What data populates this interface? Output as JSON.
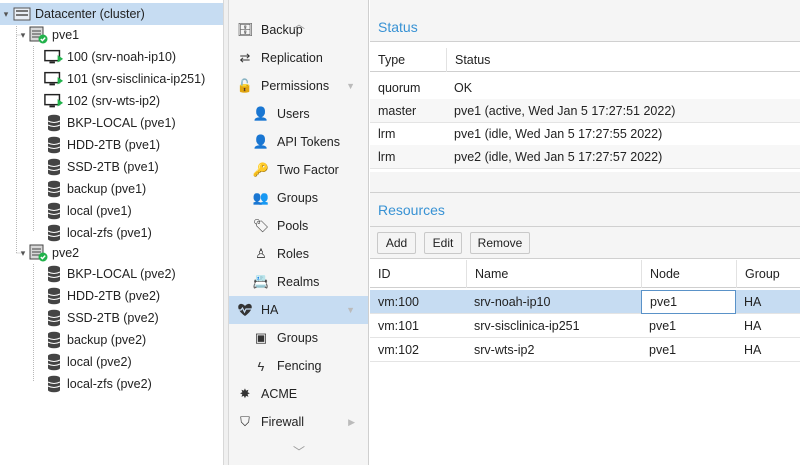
{
  "tree": {
    "datacenter": "Datacenter (cluster)",
    "nodes": [
      {
        "name": "pve1",
        "vms": [
          "100 (srv-noah-ip10)",
          "101 (srv-sisclinica-ip251)",
          "102 (srv-wts-ip2)"
        ],
        "storages": [
          "BKP-LOCAL (pve1)",
          "HDD-2TB (pve1)",
          "SSD-2TB (pve1)",
          "backup (pve1)",
          "local (pve1)",
          "local-zfs (pve1)"
        ]
      },
      {
        "name": "pve2",
        "vms": [],
        "storages": [
          "BKP-LOCAL (pve2)",
          "HDD-2TB (pve2)",
          "SSD-2TB (pve2)",
          "backup (pve2)",
          "local (pve2)",
          "local-zfs (pve2)"
        ]
      }
    ]
  },
  "nav": {
    "items": [
      "Backup",
      "Replication",
      "Permissions",
      "Users",
      "API Tokens",
      "Two Factor",
      "Groups",
      "Pools",
      "Roles",
      "Realms",
      "HA",
      "Groups",
      "Fencing",
      "ACME",
      "Firewall"
    ],
    "selected": "HA"
  },
  "status": {
    "title": "Status",
    "columns": [
      "Type",
      "Status"
    ],
    "rows": [
      {
        "type": "quorum",
        "status": "OK"
      },
      {
        "type": "master",
        "status": "pve1 (active, Wed Jan 5 17:27:51 2022)"
      },
      {
        "type": "lrm",
        "status": "pve1 (idle, Wed Jan 5 17:27:55 2022)"
      },
      {
        "type": "lrm",
        "status": "pve2 (idle, Wed Jan 5 17:27:57 2022)"
      }
    ]
  },
  "resources": {
    "title": "Resources",
    "buttons": {
      "add": "Add",
      "edit": "Edit",
      "remove": "Remove"
    },
    "columns": [
      "ID",
      "Name",
      "Node",
      "Group"
    ],
    "rows": [
      {
        "id": "vm:100",
        "name": "srv-noah-ip10",
        "node": "pve1",
        "group": "HA"
      },
      {
        "id": "vm:101",
        "name": "srv-sisclinica-ip251",
        "node": "pve1",
        "group": "HA"
      },
      {
        "id": "vm:102",
        "name": "srv-wts-ip2",
        "node": "pve1",
        "group": "HA"
      }
    ]
  },
  "colors": {
    "accent": "#3892d4",
    "selection": "#c6dcf2",
    "running": "#21b24b",
    "online": "#21b24b"
  }
}
